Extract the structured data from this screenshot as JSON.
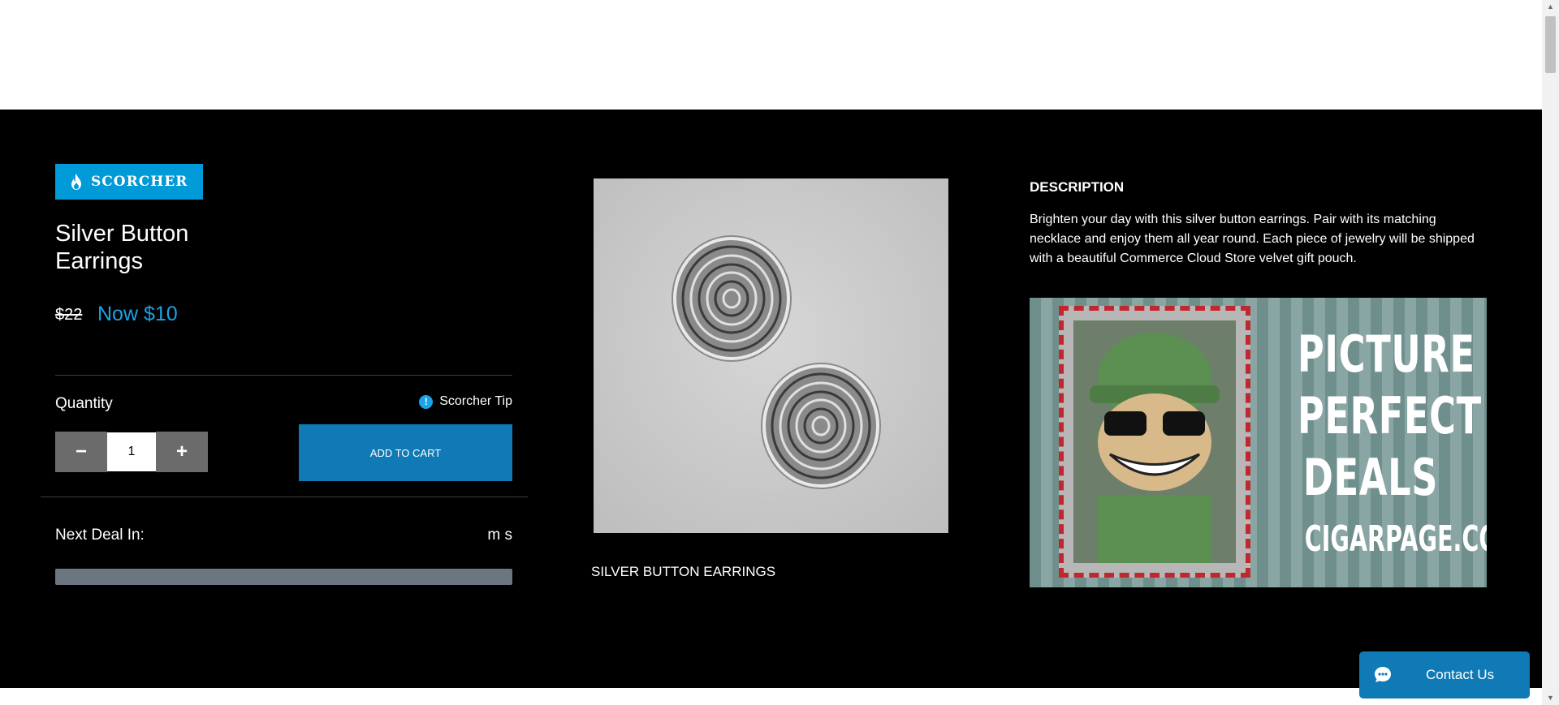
{
  "badge": {
    "label": "SCORCHER",
    "icon": "flame-icon",
    "color": "#009ad9"
  },
  "product": {
    "title": "Silver Button Earrings",
    "old_price": "$22",
    "new_price": "Now $10",
    "image_caption": "SILVER BUTTON EARRINGS",
    "image_icon": "earrings-photo"
  },
  "purchase": {
    "quantity_label": "Quantity",
    "tip_label": "Scorcher Tip",
    "tip_icon": "exclamation-icon",
    "quantity_value": "1",
    "decrement_label": "−",
    "increment_label": "+",
    "add_to_cart_label": "ADD TO CART"
  },
  "deal": {
    "next_deal_label": "Next Deal In:",
    "countdown_text": "m s",
    "progress_fraction": 1.0
  },
  "description": {
    "heading": "DESCRIPTION",
    "text": "Brighten your day with this silver button earrings. Pair with its matching necklace and enjoy them all year round. Each piece of jewelry will be shipped with a beautiful Commerce Cloud Store velvet gift pouch."
  },
  "ad": {
    "lines": [
      "PICTURE",
      "PERFECT",
      "DEALS"
    ],
    "site": "CIGARPAGE.COM"
  },
  "contact": {
    "label": "Contact Us",
    "icon": "chat-bubble-icon"
  },
  "colors": {
    "accent": "#1aa3e8",
    "button": "#0f7ab5",
    "background": "#000000"
  }
}
